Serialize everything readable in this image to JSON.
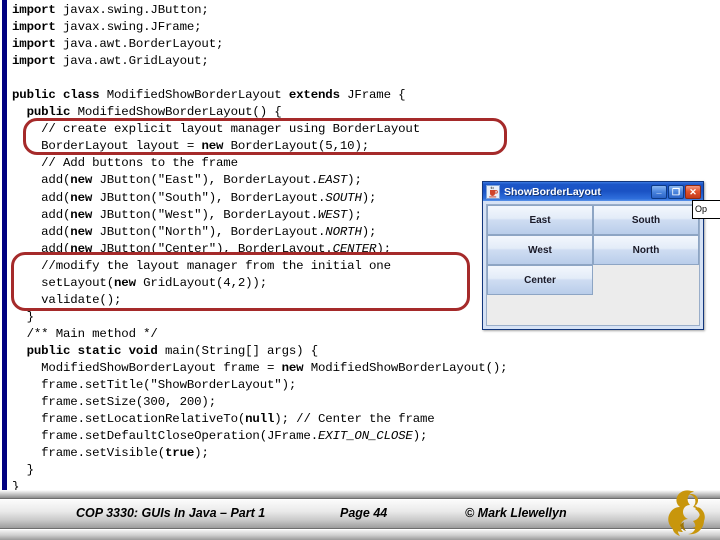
{
  "slide": {
    "accent_stripe_color": "#000080",
    "background_color": "#ffffff",
    "annotation_color": "#A52A2A"
  },
  "code": {
    "language": "java",
    "lines": [
      [
        {
          "t": "import",
          "b": true
        },
        {
          "t": " javax.swing.JButton;"
        }
      ],
      [
        {
          "t": "import",
          "b": true
        },
        {
          "t": " javax.swing.JFrame;"
        }
      ],
      [
        {
          "t": "import",
          "b": true
        },
        {
          "t": " java.awt.BorderLayout;"
        }
      ],
      [
        {
          "t": "import",
          "b": true
        },
        {
          "t": " java.awt.GridLayout;"
        }
      ],
      [
        {
          "t": ""
        }
      ],
      [
        {
          "t": "public class ",
          "b": true
        },
        {
          "t": "ModifiedShowBorderLayout "
        },
        {
          "t": "extends",
          "b": true
        },
        {
          "t": " JFrame {"
        }
      ],
      [
        {
          "t": "  "
        },
        {
          "t": "public",
          "b": true
        },
        {
          "t": " ModifiedShowBorderLayout() {"
        }
      ],
      [
        {
          "t": "    // create explicit layout manager using BorderLayout"
        }
      ],
      [
        {
          "t": "    BorderLayout layout = "
        },
        {
          "t": "new",
          "b": true
        },
        {
          "t": " BorderLayout(5,10);"
        }
      ],
      [
        {
          "t": "    // Add buttons to the frame"
        }
      ],
      [
        {
          "t": "    add("
        },
        {
          "t": "new",
          "b": true
        },
        {
          "t": " JButton(\"East\"), BorderLayout."
        },
        {
          "t": "EAST",
          "i": true
        },
        {
          "t": ");"
        }
      ],
      [
        {
          "t": "    add("
        },
        {
          "t": "new",
          "b": true
        },
        {
          "t": " JButton(\"South\"), BorderLayout."
        },
        {
          "t": "SOUTH",
          "i": true
        },
        {
          "t": ");"
        }
      ],
      [
        {
          "t": "    add("
        },
        {
          "t": "new",
          "b": true
        },
        {
          "t": " JButton(\"West\"), BorderLayout."
        },
        {
          "t": "WEST",
          "i": true
        },
        {
          "t": ");"
        }
      ],
      [
        {
          "t": "    add("
        },
        {
          "t": "new",
          "b": true
        },
        {
          "t": " JButton(\"North\"), BorderLayout."
        },
        {
          "t": "NORTH",
          "i": true
        },
        {
          "t": ");"
        }
      ],
      [
        {
          "t": "    add("
        },
        {
          "t": "new",
          "b": true
        },
        {
          "t": " JButton(\"Center\"), BorderLayout."
        },
        {
          "t": "CENTER",
          "i": true
        },
        {
          "t": ");"
        }
      ],
      [
        {
          "t": "    //modify the layout manager from the initial one"
        }
      ],
      [
        {
          "t": "    setLayout("
        },
        {
          "t": "new",
          "b": true
        },
        {
          "t": " GridLayout(4,2));"
        }
      ],
      [
        {
          "t": "    validate();"
        }
      ],
      [
        {
          "t": "  }"
        }
      ],
      [
        {
          "t": "  /** Main method */"
        }
      ],
      [
        {
          "t": "  "
        },
        {
          "t": "public static void",
          "b": true
        },
        {
          "t": " main(String[] args) {"
        }
      ],
      [
        {
          "t": "    ModifiedShowBorderLayout frame = "
        },
        {
          "t": "new",
          "b": true
        },
        {
          "t": " ModifiedShowBorderLayout();"
        }
      ],
      [
        {
          "t": "    frame.setTitle(\"ShowBorderLayout\");"
        }
      ],
      [
        {
          "t": "    frame.setSize(300, 200);"
        }
      ],
      [
        {
          "t": "    frame.setLocationRelativeTo("
        },
        {
          "t": "null",
          "b": true
        },
        {
          "t": "); // Center the frame"
        }
      ],
      [
        {
          "t": "    frame.setDefaultCloseOperation(JFrame."
        },
        {
          "t": "EXIT_ON_CLOSE",
          "i": true
        },
        {
          "t": ");"
        }
      ],
      [
        {
          "t": "    frame.setVisible("
        },
        {
          "t": "true",
          "b": true
        },
        {
          "t": ");"
        }
      ],
      [
        {
          "t": "  }"
        }
      ],
      [
        {
          "t": "}"
        }
      ]
    ]
  },
  "annotations": [
    {
      "name": "borderlayout-creation-highlight"
    },
    {
      "name": "gridlayout-modification-highlight"
    }
  ],
  "swing_window": {
    "title": "ShowBorderLayout",
    "icon": "java-coffee-cup-icon",
    "window_buttons": [
      {
        "name": "minimize-button",
        "glyph": "_"
      },
      {
        "name": "maximize-button",
        "glyph": "❐"
      },
      {
        "name": "close-button",
        "glyph": "✕"
      }
    ],
    "buttons": [
      "East",
      "South",
      "West",
      "North",
      "Center"
    ],
    "grid": {
      "rows": 4,
      "cols": 2
    },
    "empty_cells": 3
  },
  "edge_tooltip": {
    "text": "Op"
  },
  "footer": {
    "course": "COP 3330:  GUIs In Java – Part 1",
    "page": "Page 44",
    "copyright": "© Mark Llewellyn",
    "logo": "ucf-pegasus-logo"
  }
}
